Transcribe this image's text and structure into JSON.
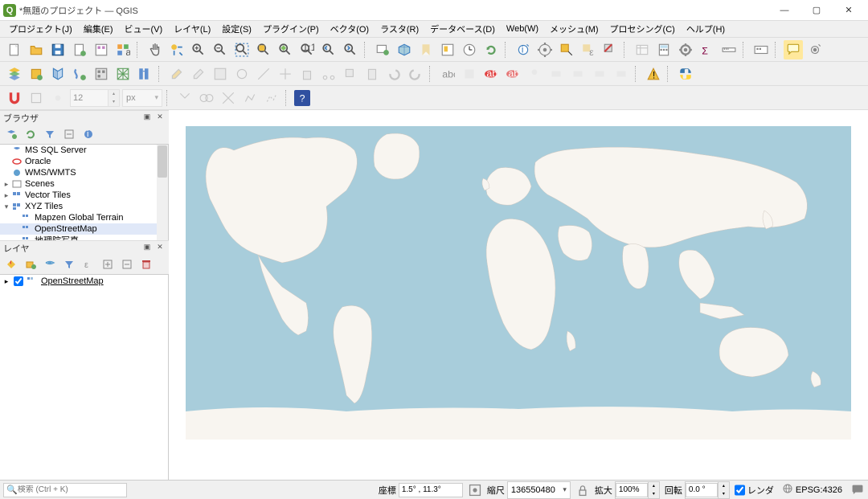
{
  "window": {
    "title": "*無題のプロジェクト — QGIS",
    "app_letter": "Q"
  },
  "menu": {
    "project": "プロジェクト(J)",
    "edit": "編集(E)",
    "view": "ビュー(V)",
    "layer": "レイヤ(L)",
    "settings": "設定(S)",
    "plugins": "プラグイン(P)",
    "vector": "ベクタ(O)",
    "raster": "ラスタ(R)",
    "database": "データベース(D)",
    "web": "Web(W)",
    "mesh": "メッシュ(M)",
    "processing": "プロセシング(C)",
    "help": "ヘルプ(H)"
  },
  "browser": {
    "title": "ブラウザ",
    "items": {
      "mssql": "MS SQL Server",
      "oracle": "Oracle",
      "wms": "WMS/WMTS",
      "scenes": "Scenes",
      "vector_tiles": "Vector Tiles",
      "xyz": "XYZ Tiles",
      "mapzen": "Mapzen Global Terrain",
      "osm": "OpenStreetMap",
      "gsi": "地理院写真"
    }
  },
  "layers": {
    "title": "レイヤ",
    "osm": "OpenStreetMap"
  },
  "snapping": {
    "tolerance": "12",
    "unit": "px"
  },
  "status": {
    "search_placeholder": "検索 (Ctrl + K)",
    "coord_label": "座標",
    "coord_value": "1.5° , 11.3°",
    "scale_label": "縮尺",
    "scale_value": "136550480",
    "magnifier_label": "拡大",
    "magnifier_value": "100%",
    "rotation_label": "回転",
    "rotation_value": "0.0 °",
    "render_label": "レンダ",
    "crs": "EPSG:4326"
  }
}
